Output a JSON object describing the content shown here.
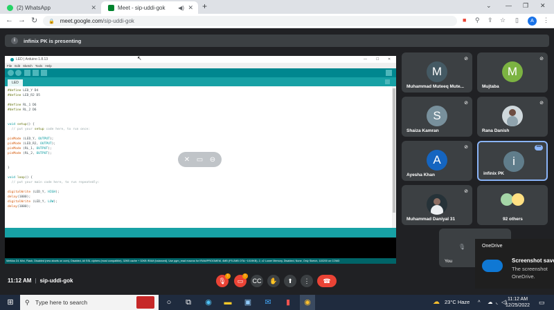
{
  "browser": {
    "tabs": [
      {
        "title": "(2) WhatsApp",
        "active": false
      },
      {
        "title": "Meet - sip-uddi-gok",
        "active": true
      }
    ],
    "url_host": "meet.google.com",
    "url_path": "/sip-uddi-gok",
    "profile_initial": "A"
  },
  "banner": {
    "text": "infinix PK is presenting"
  },
  "presentation": {
    "window_title": "LED | Arduino 1.8.13",
    "menu": [
      "File",
      "Edit",
      "Sketch",
      "Tools",
      "Help"
    ],
    "tab": "LED",
    "code": "#define LED_Y D4\n#define LED_R2 D5\n\n#define RL_1 D6\n#define RL_2 D6\n\n\nvoid setup() {\n  // put your setup code here, to run once:\n\npinMode (LED_Y, OUTPUT);\npinMode (LED_R2, OUTPUT);\npinMode (RL_1, OUTPUT);\npinMode (RL_2, OUTPUT);\n\n\n}\n\nvoid loop() {\n  // put your main code here, to run repeatedly:\n\ndigitalWrite (LED_Y, HIGH);\ndelay(1000);\ndigitalWrite (LED_Y, LOW);\ndelay(1000);",
    "status": "WeMos D1 Mini, Flash, Disabled (new aborts on oom), Disabled, All SSL ciphers (most compatible), 32KB cache + 32KB IRAM (balanced), Use pgm_read macros for IRAM/PROGMEM, 4MB (FS:2MB OTA:~1019KB), 2, v2 Lower Memory, Disabled, None, Only Sketch, 115200 on COM3"
  },
  "participants": [
    {
      "name": "Muhammad Muteeq Mute...",
      "initial": "M",
      "color": "#455a64"
    },
    {
      "name": "Mujtaba",
      "initial": "M",
      "color": "#7cb342"
    },
    {
      "name": "Shaiza Kamran",
      "initial": "S",
      "color": "#78909c"
    },
    {
      "name": "Rana Danish",
      "initial": "",
      "color": "#cfd8dc"
    },
    {
      "name": "Ayesha Khan",
      "initial": "A",
      "color": "#1565c0"
    },
    {
      "name": "infinix PK",
      "initial": "i",
      "color": "#607d8b"
    },
    {
      "name": "Muhammad Daniyal 31",
      "initial": "",
      "color": "#263238"
    },
    {
      "name": "92 others",
      "initial": "",
      "color": "#3c4043"
    }
  ],
  "self_tile": {
    "name": "You"
  },
  "meeting": {
    "time": "11:12 AM",
    "code": "sip-uddi-gok"
  },
  "controls": {
    "mic_badge": "!",
    "cam_badge": "!"
  },
  "onedrive": {
    "app": "OneDrive",
    "title": "Screenshot save",
    "line1": "The screenshot",
    "line2": "OneDrive."
  },
  "taskbar": {
    "search_placeholder": "Type here to search",
    "weather": "23°C  Haze",
    "time": "11:12 AM",
    "date": "12/25/2022"
  }
}
